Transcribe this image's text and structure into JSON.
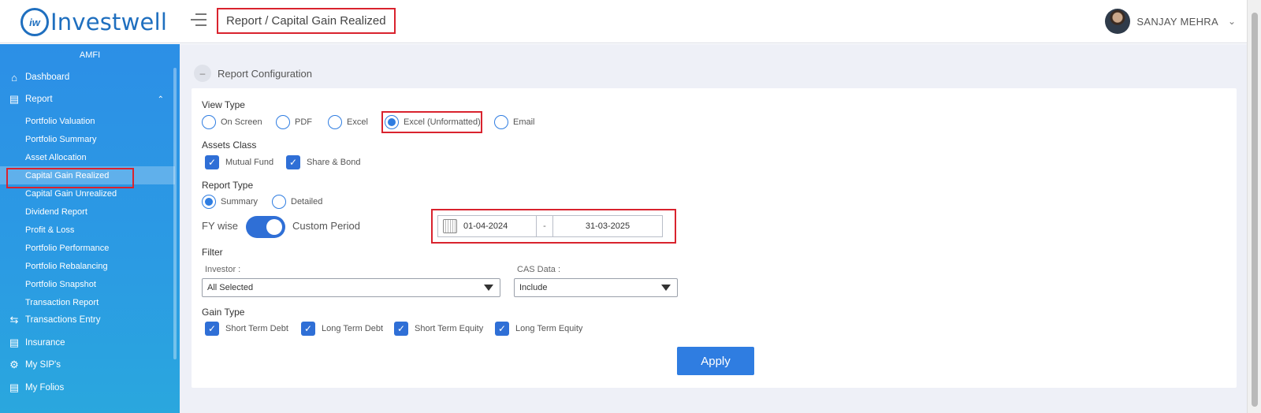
{
  "header": {
    "logo_text": "Investwell",
    "logo_mark": "iw",
    "breadcrumb": "Report / Capital Gain Realized",
    "user_name": "SANJAY MEHRA"
  },
  "sidebar": {
    "org": "AMFI",
    "items": [
      {
        "label": "Dashboard",
        "icon": "home-icon"
      },
      {
        "label": "Report",
        "icon": "report-icon"
      },
      {
        "label": "Transactions Entry",
        "icon": "swap-icon"
      },
      {
        "label": "Insurance",
        "icon": "document-icon"
      },
      {
        "label": "My SIP's",
        "icon": "sip-icon"
      },
      {
        "label": "My Folios",
        "icon": "folio-icon"
      }
    ],
    "report_sub": [
      "Portfolio Valuation",
      "Portfolio Summary",
      "Asset Allocation",
      "Capital Gain Realized",
      "Capital Gain Unrealized",
      "Dividend Report",
      "Profit & Loss",
      "Portfolio Performance",
      "Portfolio Rebalancing",
      "Portfolio Snapshot",
      "Transaction Report"
    ],
    "active_sub": "Capital Gain Realized"
  },
  "main": {
    "section_title": "Report Configuration",
    "view_type": {
      "label": "View Type",
      "options": [
        "On Screen",
        "PDF",
        "Excel",
        "Excel (Unformatted)",
        "Email"
      ],
      "selected": "Excel (Unformatted)"
    },
    "assets_class": {
      "label": "Assets Class",
      "options": [
        "Mutual Fund",
        "Share & Bond"
      ]
    },
    "report_type": {
      "label": "Report Type",
      "options": [
        "Summary",
        "Detailed"
      ],
      "selected": "Summary"
    },
    "period": {
      "left_label": "FY wise",
      "right_label": "Custom Period",
      "toggle_on": true,
      "from_date": "01-04-2024",
      "separator": "-",
      "to_date": "31-03-2025"
    },
    "filter": {
      "label": "Filter",
      "investor_label": "Investor :",
      "investor_value": "All Selected",
      "cas_label": "CAS Data :",
      "cas_value": "Include"
    },
    "gain_type": {
      "label": "Gain Type",
      "options": [
        "Short Term Debt",
        "Long Term Debt",
        "Short Term Equity",
        "Long Term Equity"
      ]
    },
    "apply_label": "Apply"
  },
  "colors": {
    "accent": "#2f7de1",
    "highlight_border": "#d9232e",
    "sidebar_top": "#2c8fe6",
    "sidebar_bottom": "#2aa7de",
    "page_bg": "#eef0f7"
  }
}
